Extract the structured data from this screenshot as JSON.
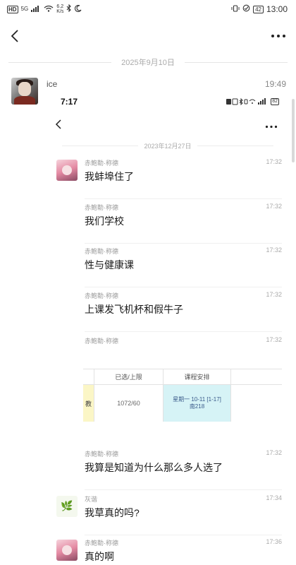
{
  "statusbar": {
    "hd": "HD",
    "network": "5G",
    "speed_value": "6.2",
    "speed_unit": "K/s",
    "battery": "42",
    "time": "13:00"
  },
  "date_separator": "2025年9月10日",
  "outer_message": {
    "sender": "ice",
    "time": "19:49"
  },
  "shot": {
    "status_time": "7:17",
    "battery": "82",
    "date_separator": "2023年12月27日",
    "messages": [
      {
        "sender": "赤鲍勒·称德",
        "time": "17:32",
        "text": "我蚌埠住了"
      },
      {
        "sender": "赤鲍勒·称德",
        "time": "17:32",
        "text": "我们学校"
      },
      {
        "sender": "赤鲍勒·称德",
        "time": "17:32",
        "text": "性与健康课"
      },
      {
        "sender": "赤鲍勒·称德",
        "time": "17:32",
        "text": "上课发飞机杯和假牛子"
      },
      {
        "sender": "赤鲍勒·称德",
        "time": "17:32",
        "text": "我算是知道为什么那么多人选了"
      },
      {
        "sender": "灰谐",
        "time": "17:34",
        "text": "我草真的吗?"
      },
      {
        "sender": "赤鲍勒·称德",
        "time": "17:36",
        "text": "真的啊"
      }
    ],
    "image_message": {
      "sender": "赤鲍勒·称德",
      "time": "17:32",
      "table": {
        "headers": [
          "",
          "已选/上限",
          "课程安排",
          ""
        ],
        "row": [
          "教",
          "1072/60",
          "星期一 10-11 [1-17]",
          "南218"
        ]
      }
    }
  }
}
